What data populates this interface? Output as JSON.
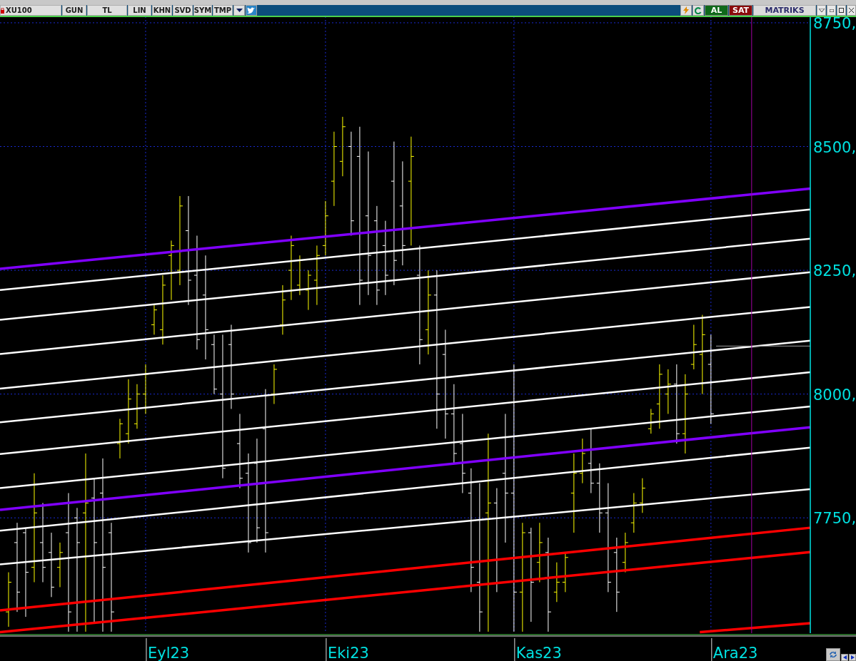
{
  "toolbar": {
    "symbol": "XU100",
    "buttons": [
      "GUN",
      "TL",
      "LIN",
      "KHN",
      "SVD",
      "SYM",
      "TMP"
    ],
    "trade_buttons": [
      {
        "label": "AL",
        "kind": "buy"
      },
      {
        "label": "SAT",
        "kind": "sell"
      }
    ],
    "brand": "MATRIKS"
  },
  "price_axis": [
    "8750,",
    "8500,",
    "8250,",
    "8000,",
    "7750,"
  ],
  "time_axis": [
    "Eyl23",
    "Eki23",
    "Kas23",
    "Ara23"
  ]
}
